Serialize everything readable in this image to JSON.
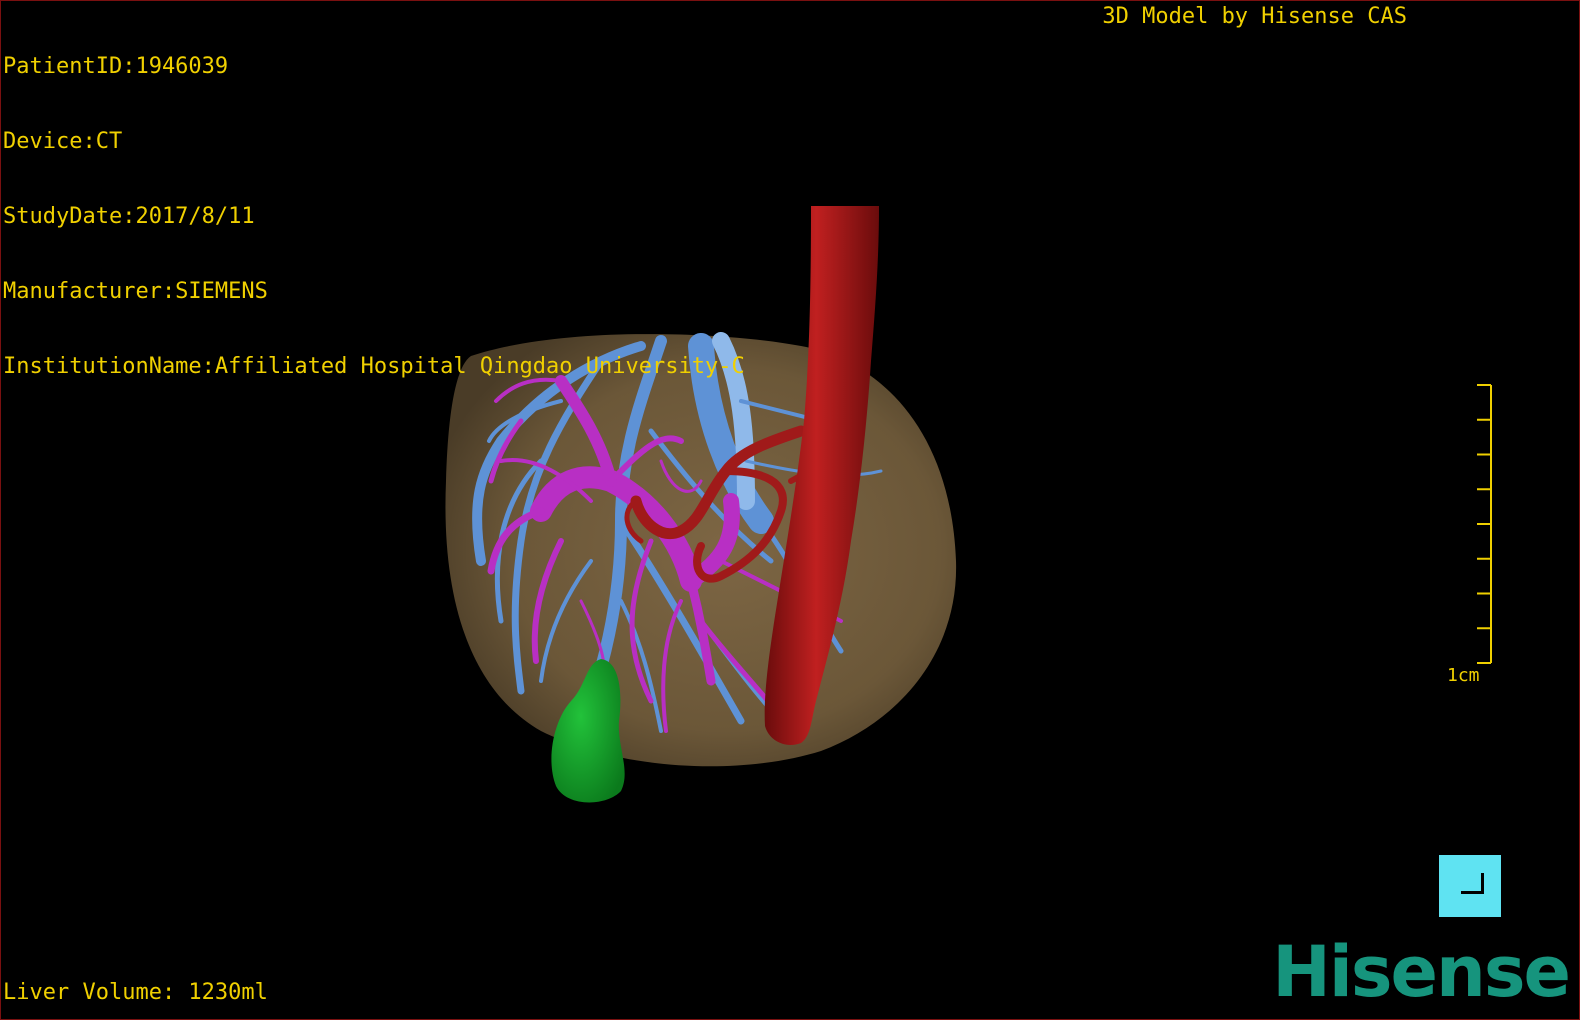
{
  "patient": {
    "id_line": "PatientID:1946039",
    "device_line": "Device:CT",
    "study_date_line": "StudyDate:2017/8/11",
    "manufacturer_line": "Manufacturer:SIEMENS",
    "institution_line": "InstitutionName:Affiliated Hospital Qingdao University-C"
  },
  "credit": "3D Model by Hisense CAS",
  "liver_volume": "Liver Volume: 1230ml",
  "scale": {
    "label": "1cm",
    "ticks": 9
  },
  "logo": "Hisense",
  "colors": {
    "text": "#f0d000",
    "liver": "#6b5738",
    "portal_vein": "#b82fc4",
    "hepatic_vein": "#5e92d6",
    "artery": "#9e1515",
    "gallbladder": "#13a32a",
    "button": "#5fe3f2",
    "logo": "#16947d"
  },
  "icons": {
    "corner_button": "corner-bracket-icon"
  }
}
